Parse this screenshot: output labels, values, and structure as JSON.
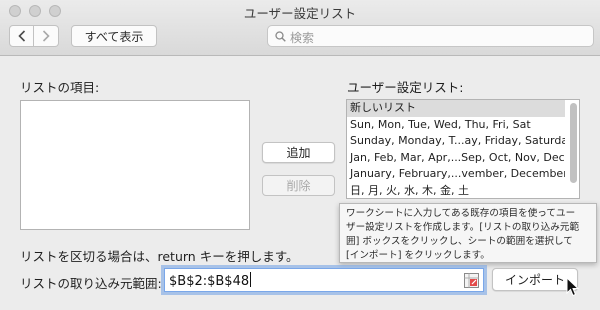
{
  "window": {
    "title": "ユーザー設定リスト"
  },
  "toolbar": {
    "back_icon": "chevron-left-icon",
    "forward_icon": "chevron-right-icon",
    "show_all_label": "すべて表示",
    "search_placeholder": "検索",
    "search_icon": "search-icon"
  },
  "left_panel": {
    "list_entries_label": "リストの項目:",
    "list_entries_value": ""
  },
  "buttons": {
    "add_label": "追加",
    "delete_label": "削除"
  },
  "custom_lists": {
    "label": "ユーザー設定リスト:",
    "items": [
      "新しいリスト",
      "Sun, Mon, Tue, Wed, Thu, Fri, Sat",
      "Sunday, Monday, T...ay, Friday, Saturday",
      "Jan, Feb, Mar, Apr,...Sep, Oct, Nov, Dec",
      "January, February,...vember, December",
      "日, 月, 火, 水, 木, 金, 土"
    ],
    "selected_index": 0
  },
  "tooltip": {
    "lines": [
      "ワークシートに入力してある既存の項目を使ってユー",
      "ザー設定リストを作成します。[リストの取り込み元範",
      "囲] ボックスをクリックし、シートの範囲を選択して",
      "[インポート] をクリックします。"
    ]
  },
  "footer": {
    "separator_hint": "リストを区切る場合は、return キーを押します。",
    "import_range_label": "リストの取り込み元範囲:",
    "import_range_value": "$B$2:$B$48",
    "range_picker_icon": "range-selector-icon",
    "import_button_label": "インポート"
  },
  "colors": {
    "window_bg": "#ececec",
    "focus_ring": "#70a0e6",
    "selected_row": "#dcdcdc"
  }
}
